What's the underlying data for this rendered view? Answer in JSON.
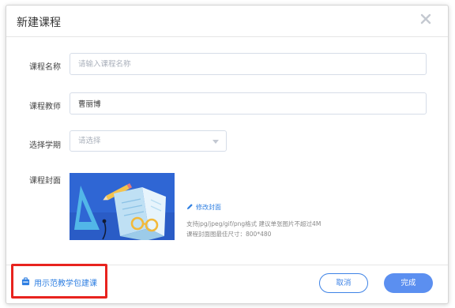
{
  "dialog": {
    "title": "新建课程",
    "close_icon": "close-icon"
  },
  "form": {
    "name": {
      "label": "课程名称",
      "placeholder": "请输入课程名称",
      "value": ""
    },
    "teacher": {
      "label": "课程教师",
      "value": "曹丽博"
    },
    "term": {
      "label": "选择学期",
      "placeholder": "请选择"
    },
    "cover": {
      "label": "课程封面",
      "edit_label": "修改封面",
      "hint_format": "支持jpg/jpeg/gif/png格式 建议单张图片不超过4M",
      "hint_size": "课程封面图最佳尺寸：800*480"
    }
  },
  "footer": {
    "template_link": "用示范教学包建课",
    "cancel_label": "取消",
    "done_label": "完成"
  },
  "colors": {
    "accent": "#2f7fe2",
    "primary_button": "#5b8ff0",
    "highlight_box": "#e8231e",
    "cover_bg": "#2f66d4"
  }
}
